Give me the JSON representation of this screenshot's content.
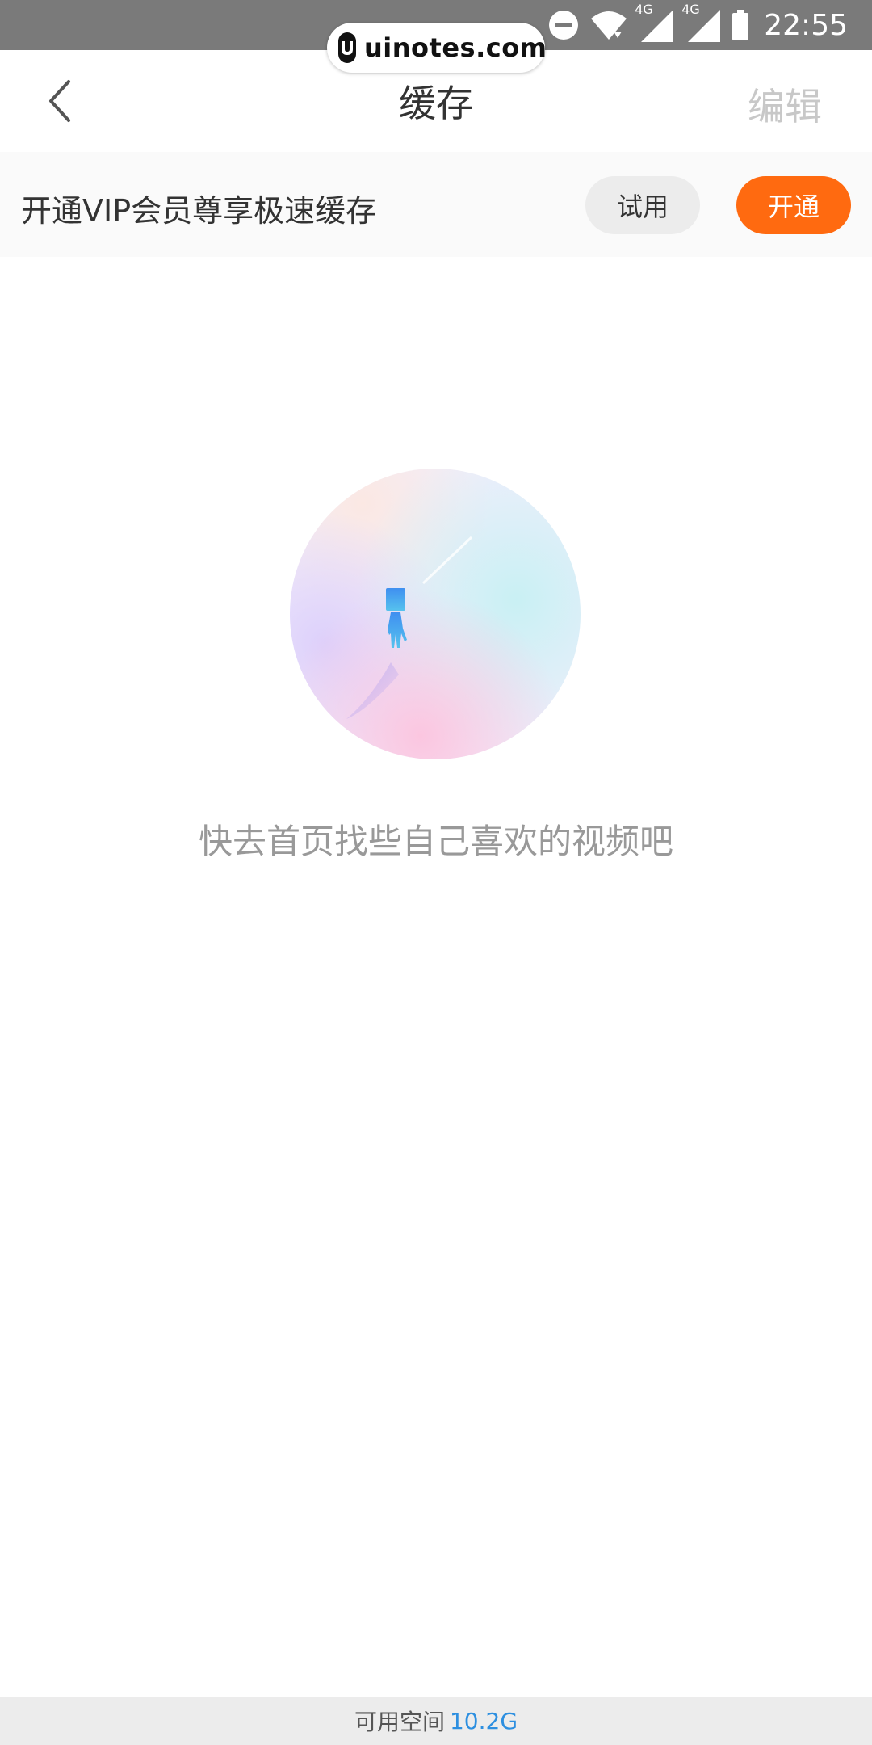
{
  "status_bar": {
    "time": "22:55",
    "network_label_1": "4G",
    "network_label_2": "4G",
    "icons": [
      "dnd-icon",
      "wifi-icon",
      "signal-icon",
      "signal-icon",
      "battery-icon"
    ]
  },
  "watermark": {
    "text": "uinotes.com"
  },
  "nav": {
    "title": "缓存",
    "edit_label": "编辑",
    "back_icon": "back-chevron-icon"
  },
  "vip_banner": {
    "text": "开通VIP会员尊享极速缓存",
    "trial_label": "试用",
    "open_label": "开通"
  },
  "empty_state": {
    "message": "快去首页找些自己喜欢的视频吧",
    "illustration": "empty-illustration"
  },
  "footer": {
    "storage_label": "可用空间",
    "storage_value": "10.2G"
  },
  "colors": {
    "status_bar": "#7a7a7a",
    "accent_orange": "#ff6a10",
    "storage_blue": "#2d8fe0",
    "edit_disabled": "#c8c8c8"
  }
}
